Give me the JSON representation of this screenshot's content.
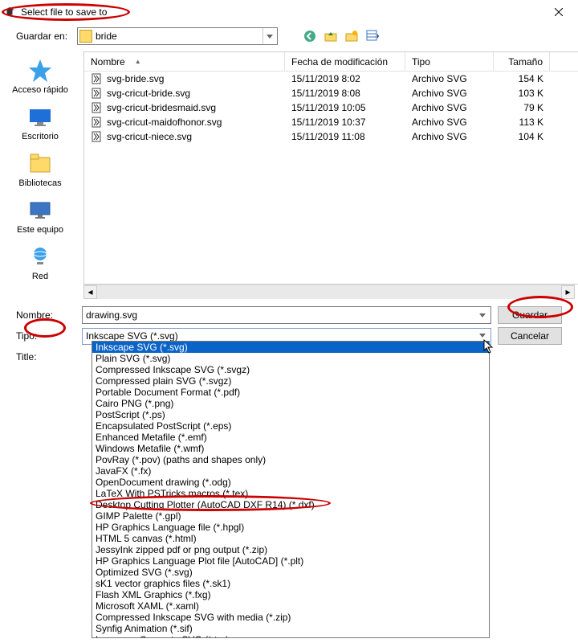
{
  "window": {
    "title": "Select file to save to"
  },
  "toolbar": {
    "save_in_label": "Guardar en:",
    "folder_name": "bride"
  },
  "places": {
    "quick": {
      "label": "Acceso rápido"
    },
    "desktop": {
      "label": "Escritorio"
    },
    "libs": {
      "label": "Bibliotecas"
    },
    "pc": {
      "label": "Este equipo"
    },
    "net": {
      "label": "Red"
    }
  },
  "columns": {
    "name": "Nombre",
    "date": "Fecha de modificación",
    "type": "Tipo",
    "size": "Tamaño"
  },
  "files": [
    {
      "name": "svg-bride.svg",
      "date": "15/11/2019 8:02",
      "type": "Archivo SVG",
      "size": "154 K"
    },
    {
      "name": "svg-cricut-bride.svg",
      "date": "15/11/2019 8:08",
      "type": "Archivo SVG",
      "size": "103 K"
    },
    {
      "name": "svg-cricut-bridesmaid.svg",
      "date": "15/11/2019 10:05",
      "type": "Archivo SVG",
      "size": "79 K"
    },
    {
      "name": "svg-cricut-maidofhonor.svg",
      "date": "15/11/2019 10:37",
      "type": "Archivo SVG",
      "size": "113 K"
    },
    {
      "name": "svg-cricut-niece.svg",
      "date": "15/11/2019 11:08",
      "type": "Archivo SVG",
      "size": "104 K"
    }
  ],
  "bottom": {
    "name_label": "Nombre:",
    "filename": "drawing.svg",
    "type_label": "Tipo:",
    "type_value": "Inkscape SVG (*.svg)",
    "title_label": "Title:",
    "save_btn": "Guardar",
    "cancel_btn": "Cancelar"
  },
  "type_options": [
    "Inkscape SVG (*.svg)",
    "Plain SVG (*.svg)",
    "Compressed Inkscape SVG (*.svgz)",
    "Compressed plain SVG (*.svgz)",
    "Portable Document Format (*.pdf)",
    "Cairo PNG (*.png)",
    "PostScript (*.ps)",
    "Encapsulated PostScript (*.eps)",
    "Enhanced Metafile (*.emf)",
    "Windows Metafile (*.wmf)",
    "PovRay (*.pov) (paths and shapes only)",
    "JavaFX (*.fx)",
    "OpenDocument drawing (*.odg)",
    "LaTeX With PSTricks macros (*.tex)",
    "Desktop Cutting Plotter (AutoCAD DXF R14) (*.dxf)",
    "GIMP Palette (*.gpl)",
    "HP Graphics Language file (*.hpgl)",
    "HTML 5 canvas (*.html)",
    "JessyInk zipped pdf or png output (*.zip)",
    "HP Graphics Language Plot file [AutoCAD] (*.plt)",
    "Optimized SVG (*.svg)",
    "sK1 vector graphics files (*.sk1)",
    "Flash XML Graphics (*.fxg)",
    "Microsoft XAML (*.xaml)",
    "Compressed Inkscape SVG with media (*.zip)",
    "Synfig Animation (*.sif)",
    "Layers as Separate SVG (*.tar)"
  ]
}
